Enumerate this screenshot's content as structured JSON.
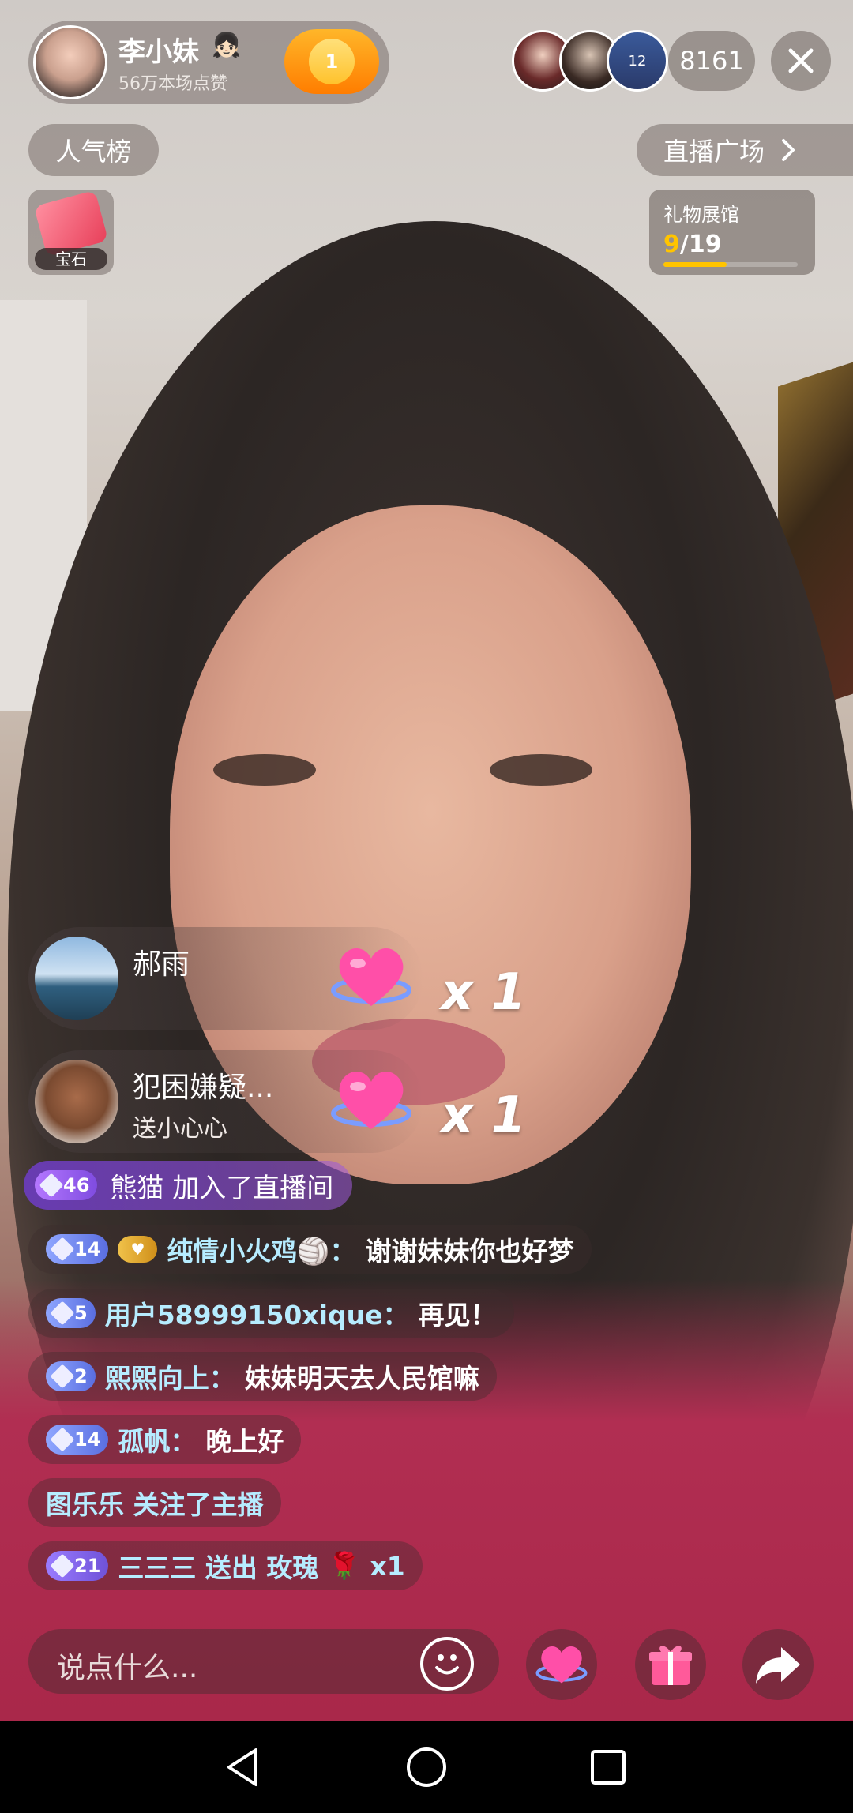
{
  "anchor": {
    "name": "李小妹",
    "name_emoji": "👧🏻",
    "likes": "56万本场点赞",
    "follow_badge": "1"
  },
  "viewers": {
    "count": "8161",
    "avatar_badge": "12"
  },
  "rank_button": "人气榜",
  "plaza_button": "直播广场",
  "gem_box": {
    "label": "宝石"
  },
  "gift_hall": {
    "title": "礼物展馆",
    "current": "9",
    "total": "/19",
    "progress": 0.47
  },
  "gift_events": [
    {
      "user": "郝雨",
      "action": "",
      "multiplier": "x 1"
    },
    {
      "user": "犯困嫌疑...",
      "action": "送小心心",
      "multiplier": "x 1"
    }
  ],
  "join_event": {
    "level": "46",
    "text": "熊猫 加入了直播间"
  },
  "chat": [
    {
      "level": "14",
      "name": "纯情小火鸡",
      "emoji": "🏐",
      "sep": "：",
      "message": "谢谢妹妹你也好梦"
    },
    {
      "level": "5",
      "name": "用户58999150xique",
      "sep": "：",
      "message": "再见！"
    },
    {
      "level": "2",
      "name": "熙熙向上",
      "sep": "：",
      "message": "妹妹明天去人民馆嘛"
    },
    {
      "level": "14",
      "name": "孤帆",
      "sep": "：",
      "message": "晚上好"
    }
  ],
  "follow_event": {
    "text": "图乐乐 关注了主播"
  },
  "gift_chat": {
    "level": "21",
    "text": "三三三 送出 玫瑰",
    "emoji": "🌹",
    "count": "x1"
  },
  "input": {
    "placeholder": "说点什么..."
  },
  "colors": {
    "accent_orange": "#ff8a00",
    "chat_name": "#b6ecff",
    "gift_hall_progress": "#ffc400",
    "join_purple": "#7f4ce0"
  },
  "icons": [
    "close-icon",
    "chevron-right-icon",
    "emoji-icon",
    "heart-icon",
    "gift-icon",
    "share-icon",
    "back-icon",
    "home-icon",
    "recents-icon"
  ]
}
